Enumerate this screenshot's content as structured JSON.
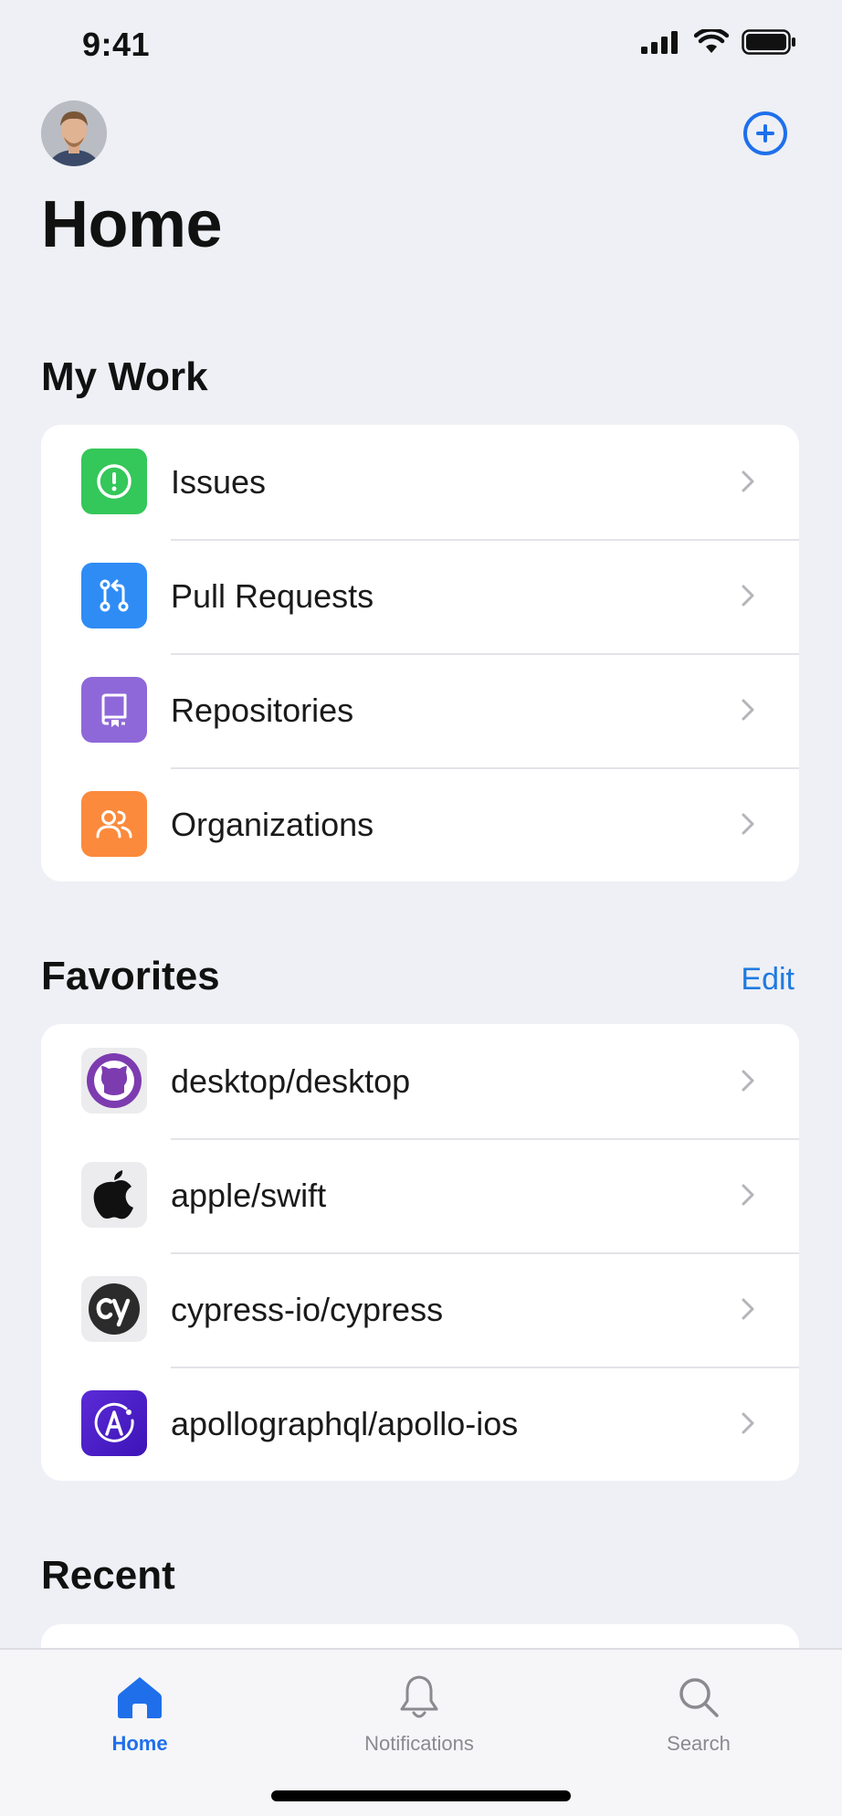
{
  "status_bar": {
    "time": "9:41"
  },
  "header": {
    "title": "Home"
  },
  "my_work": {
    "title": "My Work",
    "items": [
      {
        "label": "Issues",
        "icon": "issues-icon",
        "color": "#34c759"
      },
      {
        "label": "Pull Requests",
        "icon": "pull-request-icon",
        "color": "#2f8cf5"
      },
      {
        "label": "Repositories",
        "icon": "repository-icon",
        "color": "#8e68d8"
      },
      {
        "label": "Organizations",
        "icon": "organizations-icon",
        "color": "#fb8a3c"
      }
    ]
  },
  "favorites": {
    "title": "Favorites",
    "edit_label": "Edit",
    "items": [
      {
        "label": "desktop/desktop",
        "icon": "github-desktop-icon"
      },
      {
        "label": "apple/swift",
        "icon": "apple-icon"
      },
      {
        "label": "cypress-io/cypress",
        "icon": "cypress-icon"
      },
      {
        "label": "apollographql/apollo-ios",
        "icon": "apollo-icon"
      }
    ]
  },
  "recent": {
    "title": "Recent"
  },
  "tab_bar": {
    "tabs": [
      {
        "label": "Home",
        "icon": "home-icon",
        "active": true
      },
      {
        "label": "Notifications",
        "icon": "bell-icon",
        "active": false
      },
      {
        "label": "Search",
        "icon": "search-icon",
        "active": false
      }
    ]
  },
  "colors": {
    "accent": "#1f6feb",
    "background": "#eef0f5"
  }
}
